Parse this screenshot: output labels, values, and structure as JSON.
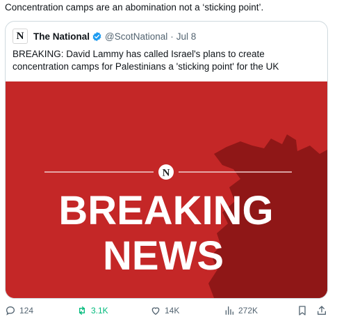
{
  "post": {
    "text": "Concentration camps are an abomination not a ‘sticking point’."
  },
  "quote": {
    "logo_letter": "N",
    "author_name": "The National",
    "handle": "@ScotNational",
    "separator": "·",
    "date": "Jul 8",
    "text": "BREAKING: David Lammy has called Israel's plans to create concentration camps for Palestinians a 'sticking point' for the UK",
    "image": {
      "logo_letter": "N",
      "line1": "BREAKING",
      "line2": "NEWS",
      "background_color": "#c42727",
      "map_color": "#8f1717"
    }
  },
  "actions": {
    "replies": "124",
    "reposts": "3.1K",
    "likes": "14K",
    "views": "272K"
  },
  "colors": {
    "text": "#0f1419",
    "muted": "#536471",
    "verified": "#1d9bf0",
    "repost_active": "#00ba7c"
  }
}
